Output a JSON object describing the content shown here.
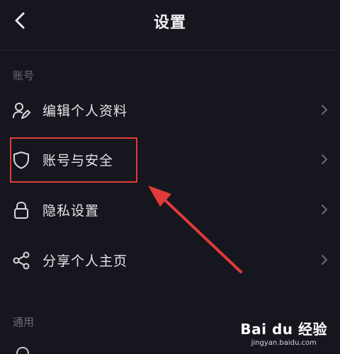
{
  "header": {
    "title": "设置"
  },
  "sections": [
    {
      "label": "账号",
      "items": [
        {
          "label": "编辑个人资料",
          "icon": "edit-profile-icon"
        },
        {
          "label": "账号与安全",
          "icon": "shield-icon"
        },
        {
          "label": "隐私设置",
          "icon": "lock-icon"
        },
        {
          "label": "分享个人主页",
          "icon": "share-icon"
        }
      ]
    },
    {
      "label": "通用",
      "items": []
    }
  ],
  "annotation": {
    "highlight_color": "#e23a3a",
    "highlighted_item": "账号与安全"
  },
  "watermark": {
    "logo": "Bai du 经验",
    "url": "jingyan.baidu.com"
  },
  "colors": {
    "background": "#16161e",
    "text": "#e4e4e8",
    "muted": "#6b6b73"
  }
}
